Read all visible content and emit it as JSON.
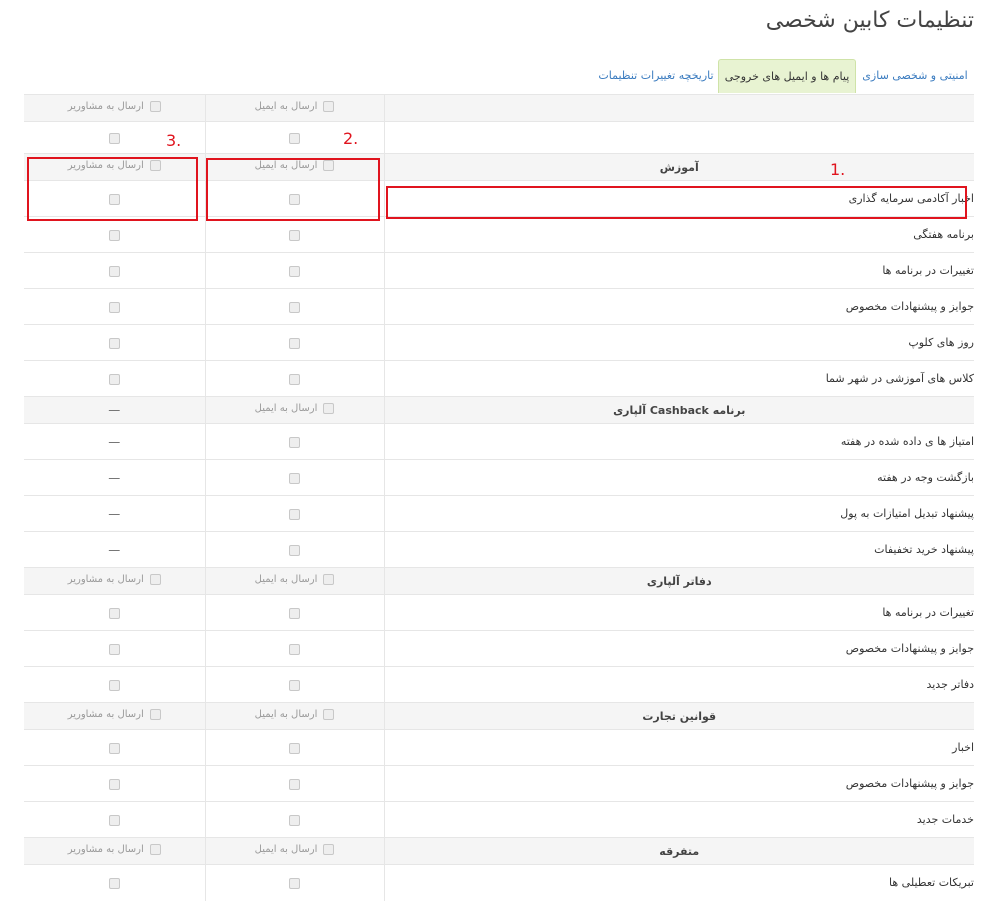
{
  "page_title": "تنظیمات کابین شخصی",
  "tabs": [
    {
      "label": "امنیتی و شخصی سازی",
      "active": false
    },
    {
      "label": "پیام ها و ایمیل های خروجی",
      "active": true
    },
    {
      "label": "تاریخچه تغییرات تنظیمات",
      "active": false
    }
  ],
  "columns": {
    "email_label": "ارسال به ایمیل",
    "supervisor_label": "ارسال به مشاوریر"
  },
  "dash": "—",
  "sections": [
    {
      "title": "آموزش",
      "items": [
        "اخبار آکادمی سرمایه گذاری",
        "برنامه هفتگی",
        "تغییرات در برنامه ها",
        "جوایز و پیشنهادات مخصوص",
        "روز های کلوپ",
        "کلاس های آموزشی در شهر شما"
      ]
    },
    {
      "title": "برنامه Cashback آلپاری",
      "items": [
        "امتیاز ها ی داده شده در هفته",
        "بازگشت وجه در هفته",
        "پیشنهاد تبدیل امتیازات به پول",
        "پیشنهاد خرید تخفیفات"
      ]
    },
    {
      "title": "دفاتر آلپاری",
      "items": [
        "تغییرات در برنامه ها",
        "جوایز و پیشنهادات مخصوص",
        "دفاتر جدید"
      ]
    },
    {
      "title": "قوانین تجارت",
      "items": [
        "اخبار",
        "جوایز و پیشنهادات مخصوص",
        "خدمات جدید"
      ]
    },
    {
      "title": "متفرقه",
      "items": [
        "تبریکات تعطیلی ها"
      ]
    }
  ],
  "annotations": [
    "1.",
    "2.",
    "3."
  ]
}
